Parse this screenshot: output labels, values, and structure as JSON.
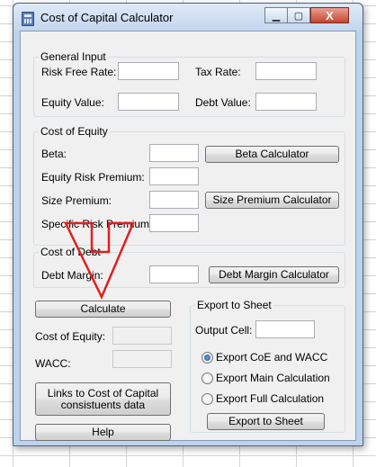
{
  "window": {
    "title": "Cost of Capital Calculator",
    "controls": {
      "minimize": "▁",
      "maximize": "▢",
      "close": "X"
    }
  },
  "general_input": {
    "legend": "General Input",
    "risk_free_rate_label": "Risk Free Rate:",
    "tax_rate_label": "Tax Rate:",
    "equity_value_label": "Equity Value:",
    "debt_value_label": "Debt Value:"
  },
  "cost_of_equity": {
    "legend": "Cost of Equity",
    "beta_label": "Beta:",
    "beta_calculator_button": "Beta Calculator",
    "equity_risk_premium_label": "Equity Risk Premium:",
    "size_premium_label": "Size Premium:",
    "size_premium_calculator_button": "Size Premium Calculator",
    "specific_risk_premium_label": "Specific Risk Premium:"
  },
  "cost_of_debt": {
    "legend": "Cost of Debt",
    "debt_margin_label": "Debt Margin:",
    "debt_margin_calculator_button": "Debt Margin Calculator"
  },
  "results": {
    "calculate_button": "Calculate",
    "cost_of_equity_label": "Cost of Equity:",
    "wacc_label": "WACC:",
    "links_button": "Links to Cost of Capital consistuents data",
    "help_button": "Help"
  },
  "export": {
    "legend": "Export to Sheet",
    "output_cell_label": "Output Cell:",
    "options": [
      {
        "label": "Export CoE and WACC",
        "selected": true
      },
      {
        "label": "Export Main Calculation",
        "selected": false
      },
      {
        "label": "Export Full Calculation",
        "selected": false
      }
    ],
    "export_button": "Export to Sheet"
  },
  "annotation": {
    "arrow_color": "#e02020"
  }
}
